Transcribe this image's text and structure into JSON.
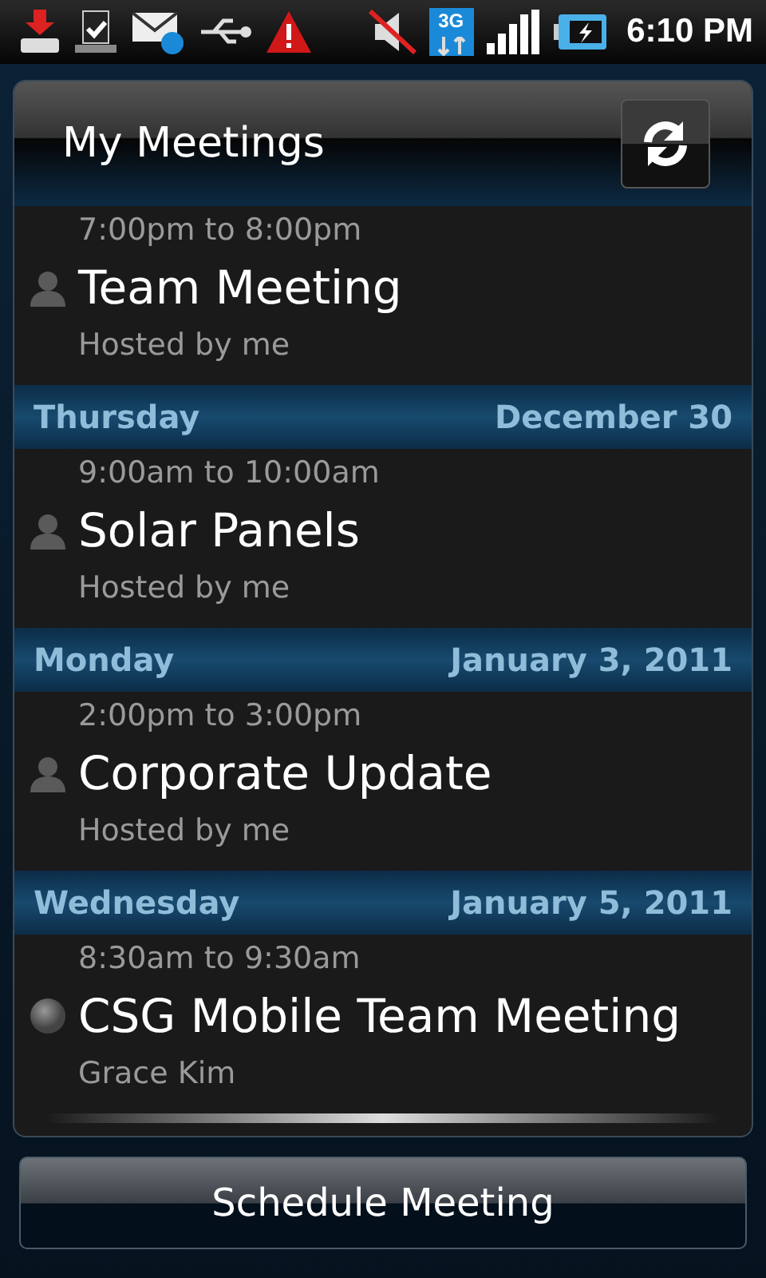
{
  "status_bar": {
    "time": "6:10 PM",
    "network": "3G"
  },
  "header": {
    "title": "My Meetings"
  },
  "list": [
    {
      "kind": "hosted",
      "time": "7:00pm to 8:00pm",
      "title": "Team Meeting",
      "subtitle": "Hosted by me"
    },
    {
      "kind": "day",
      "day": "Thursday",
      "date": "December 30"
    },
    {
      "kind": "hosted",
      "time": "9:00am to 10:00am",
      "title": "Solar Panels",
      "subtitle": "Hosted by me"
    },
    {
      "kind": "day",
      "day": "Monday",
      "date": "January 3, 2011"
    },
    {
      "kind": "hosted",
      "time": "2:00pm to 3:00pm",
      "title": "Corporate Update",
      "subtitle": "Hosted by me"
    },
    {
      "kind": "day",
      "day": "Wednesday",
      "date": "January 5, 2011"
    },
    {
      "kind": "invited",
      "time": "8:30am to 9:30am",
      "title": "CSG Mobile Team Meeting",
      "subtitle": "Grace Kim"
    }
  ],
  "button": "Schedule Meeting"
}
